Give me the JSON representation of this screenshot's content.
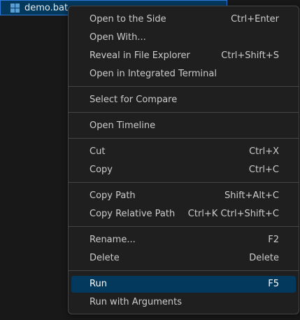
{
  "explorer": {
    "file": {
      "name": "demo.bat",
      "icon": "windows-batch-file-icon",
      "icon_color": "#5a9fd4"
    }
  },
  "context_menu": {
    "items": [
      {
        "label": "Open to the Side",
        "shortcut": "Ctrl+Enter"
      },
      {
        "label": "Open With...",
        "shortcut": ""
      },
      {
        "label": "Reveal in File Explorer",
        "shortcut": "Ctrl+Shift+S"
      },
      {
        "label": "Open in Integrated Terminal",
        "shortcut": ""
      },
      {
        "label": "Select for Compare",
        "shortcut": ""
      },
      {
        "label": "Open Timeline",
        "shortcut": ""
      },
      {
        "label": "Cut",
        "shortcut": "Ctrl+X"
      },
      {
        "label": "Copy",
        "shortcut": "Ctrl+C"
      },
      {
        "label": "Copy Path",
        "shortcut": "Shift+Alt+C"
      },
      {
        "label": "Copy Relative Path",
        "shortcut": "Ctrl+K Ctrl+Shift+C"
      },
      {
        "label": "Rename...",
        "shortcut": "F2"
      },
      {
        "label": "Delete",
        "shortcut": "Delete"
      },
      {
        "label": "Run",
        "shortcut": "F5",
        "selected": true
      },
      {
        "label": "Run with Arguments",
        "shortcut": ""
      }
    ]
  },
  "colors": {
    "menu_background": "#1f1f1f",
    "selection": "#04395e",
    "separator": "#454545",
    "text": "#cccccc"
  }
}
